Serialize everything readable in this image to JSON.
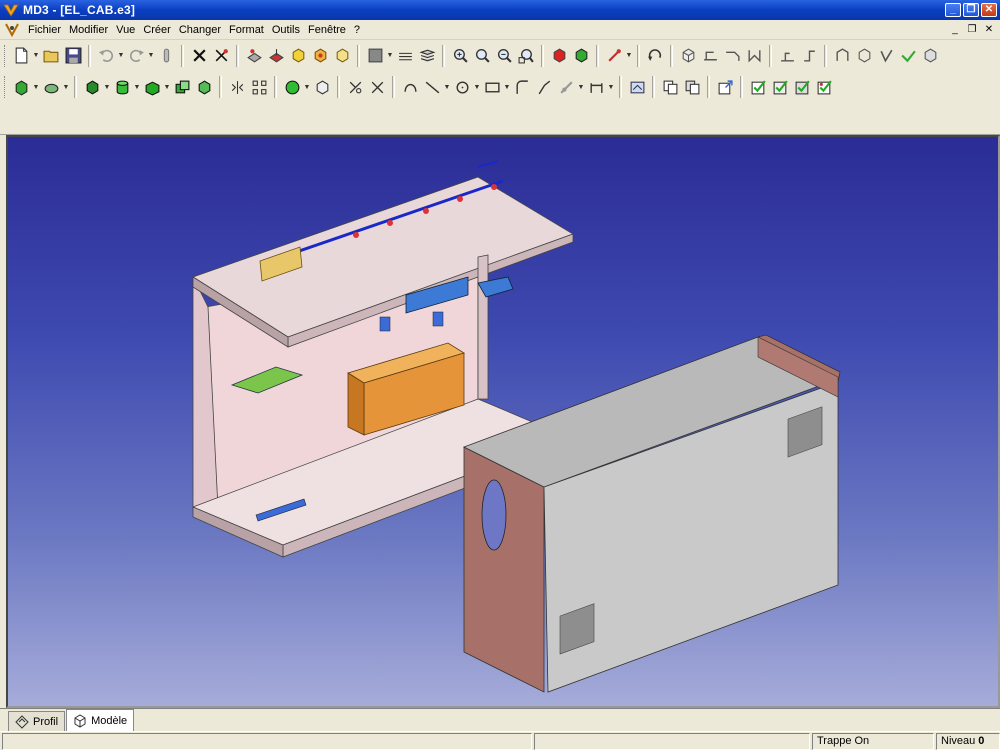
{
  "window": {
    "title": "MD3 - [EL_CAB.e3]",
    "minimize_glyph": "_",
    "maximize_glyph": "❐",
    "close_glyph": "✕"
  },
  "menubar": {
    "items": [
      {
        "label": "Fichier"
      },
      {
        "label": "Modifier"
      },
      {
        "label": "Vue"
      },
      {
        "label": "Créer"
      },
      {
        "label": "Changer"
      },
      {
        "label": "Format"
      },
      {
        "label": "Outils"
      },
      {
        "label": "Fenêtre"
      },
      {
        "label": "?"
      }
    ],
    "mdi_minimize": "_",
    "mdi_restore": "❐",
    "mdi_close": "✕"
  },
  "toolbar1": {
    "icons": [
      "new-icon",
      "open-icon",
      "save-icon",
      "undo-icon",
      "redo-icon",
      "pin-icon",
      "delete-icon",
      "cut-tool-icon",
      "hole-icon",
      "color-icon",
      "box-yellow-icon",
      "box-orange-icon",
      "box-outline-icon",
      "display-mode-icon",
      "layer-icon",
      "layers-icon",
      "zoom-in-icon",
      "zoom-all-icon",
      "zoom-window-icon",
      "zoom-prev-icon",
      "shade-icon",
      "shade-edges-icon",
      "pick-icon",
      "rotate-icon",
      "iso-view-icon",
      "front-view-icon",
      "top-view-icon",
      "side-view-icon",
      "unfold-icon",
      "fold-icon",
      "sheet-icon",
      "bend-icon",
      "corner-icon",
      "flange-icon",
      "flatten-icon"
    ]
  },
  "toolbar2": {
    "icons": [
      "extrude-icon",
      "revolve-icon",
      "box-solid-icon",
      "cylinder-icon",
      "sweep-icon",
      "boolean-icon",
      "shell-icon",
      "mirror-icon",
      "pattern-icon",
      "sphere-icon",
      "cone-icon",
      "fillet-icon",
      "chamfer-icon",
      "spline-icon",
      "line-icon",
      "circle-icon",
      "rectangle-icon",
      "arc-icon",
      "tangent-arc-icon",
      "point-icon",
      "dimension-icon",
      "sketch-icon",
      "copy-icon",
      "move-icon",
      "export-icon",
      "check-icon",
      "check2-icon",
      "check3-icon",
      "check4-icon"
    ]
  },
  "viewport": {
    "description_color_top": "#2b2c95",
    "description_color_bottom": "#a6acd9"
  },
  "tabs": [
    {
      "label": "Profil",
      "icon": "profile-icon",
      "active": false
    },
    {
      "label": "Modèle",
      "icon": "model-icon",
      "active": true
    }
  ],
  "status": {
    "snap": "Trappe On",
    "level_label": "Niveau",
    "level_value": "0"
  }
}
